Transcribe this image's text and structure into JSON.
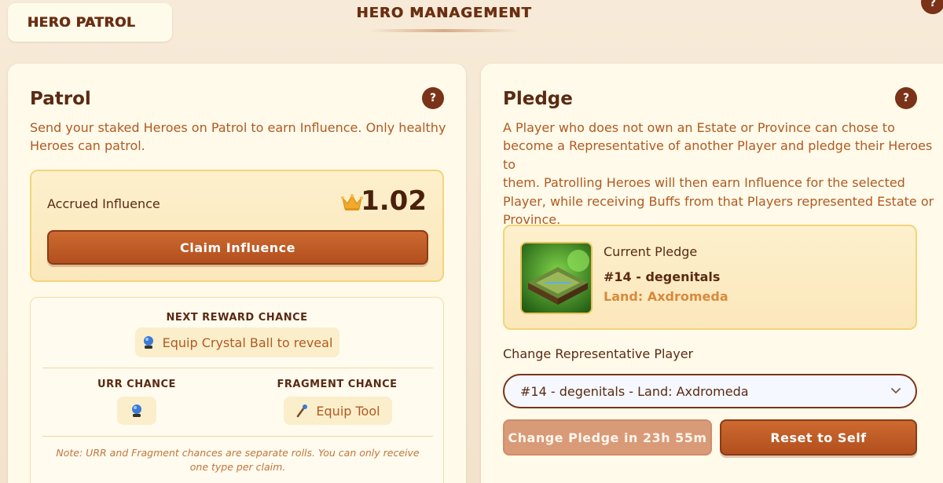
{
  "nav": {
    "tab_label": "HERO PATROL",
    "help_label": "?"
  },
  "header": {
    "title": "HERO MANAGEMENT"
  },
  "patrol": {
    "title": "Patrol",
    "help_label": "?",
    "description_line1": "Send your staked Heroes on Patrol to earn Influence. Only healthy",
    "description_line2": "Heroes can patrol.",
    "accrued_label": "Accrued Influence",
    "accrued_value": "1.02",
    "claim_button": "Claim Influence",
    "next_reward_heading": "NEXT REWARD CHANCE",
    "crystal_ball_text": "Equip Crystal Ball to reveal",
    "urr_heading": "URR CHANCE",
    "fragment_heading": "FRAGMENT CHANCE",
    "equip_tool_text": "Equip Tool",
    "note_line1": "Note: URR and Fragment chances are separate rolls. You can only receive",
    "note_line2": "one type per claim."
  },
  "pledge": {
    "title": "Pledge",
    "help_label": "?",
    "description_lines": [
      "A Player who does not own an Estate or Province can chose to",
      "become a Representative of another Player and pledge their Heroes to",
      "them. Patrolling Heroes will then earn Influence for the selected",
      "Player, while receiving Buffs from that Players represented Estate or",
      "Province."
    ],
    "current_label": "Current Pledge",
    "current_player": "#14 - degenitals",
    "current_land": "Land: Axdromeda",
    "change_label": "Change Representative Player",
    "select_value": "#14 - degenitals - Land: Axdromeda",
    "change_button": "Change Pledge in 23h 55m",
    "reset_button": "Reset to Self"
  },
  "colors": {
    "accent_brown": "#7a3318",
    "button_orange": "#b24f1e",
    "text_orange": "#b05a22",
    "highlight_border": "#f2d57a"
  },
  "icons": [
    "crown-icon",
    "crystal-ball-icon",
    "tool-icon",
    "chevron-down-icon",
    "help-icon"
  ]
}
